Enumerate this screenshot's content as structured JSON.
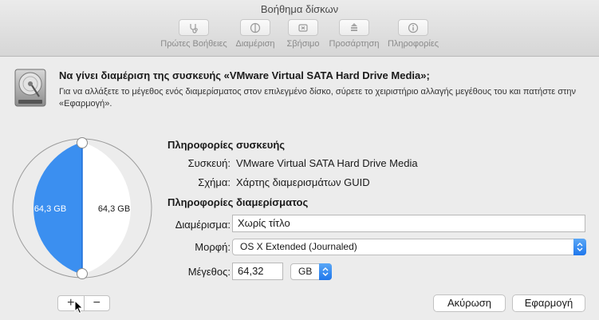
{
  "window": {
    "title": "Βοήθημα δίσκων"
  },
  "toolbar": {
    "items": [
      {
        "label": "Πρώτες Βοήθειες",
        "icon": "stethoscope-icon"
      },
      {
        "label": "Διαμέριση",
        "icon": "partition-pie-icon"
      },
      {
        "label": "Σβήσιμο",
        "icon": "erase-icon"
      },
      {
        "label": "Προσάρτηση",
        "icon": "mount-icon"
      },
      {
        "label": "Πληροφορίες",
        "icon": "info-icon"
      }
    ]
  },
  "dialog": {
    "question": "Να γίνει διαμέριση της συσκευής «VMware Virtual SATA Hard Drive Media»;",
    "instructions": "Για να αλλάξετε το μέγεθος ενός διαμερίσματος στον επιλεγμένο δίσκο, σύρετε το χειριστήριο αλλαγής μεγέθους του και πατήστε στην «Εφαρμογή»."
  },
  "pie": {
    "left_label": "64,3 GB",
    "right_label": "64,3 GB",
    "selected_color": "#3b8ff0",
    "fraction_selected": 0.5
  },
  "device_info": {
    "title": "Πληροφορίες συσκευής",
    "device_label": "Συσκευή:",
    "device_value": "VMware Virtual SATA Hard Drive Media",
    "scheme_label": "Σχήμα:",
    "scheme_value": "Χάρτης διαμερισμάτων GUID"
  },
  "partition_info": {
    "title": "Πληροφορίες διαμερίσματος",
    "name_label": "Διαμέρισμα:",
    "name_value": "Χωρίς τίτλο",
    "format_label": "Μορφή:",
    "format_value": "OS X Extended (Journaled)",
    "size_label": "Μέγεθος:",
    "size_value": "64,32",
    "unit_value": "GB"
  },
  "buttons": {
    "add": "+",
    "remove": "−",
    "cancel": "Ακύρωση",
    "apply": "Εφαρμογή"
  }
}
